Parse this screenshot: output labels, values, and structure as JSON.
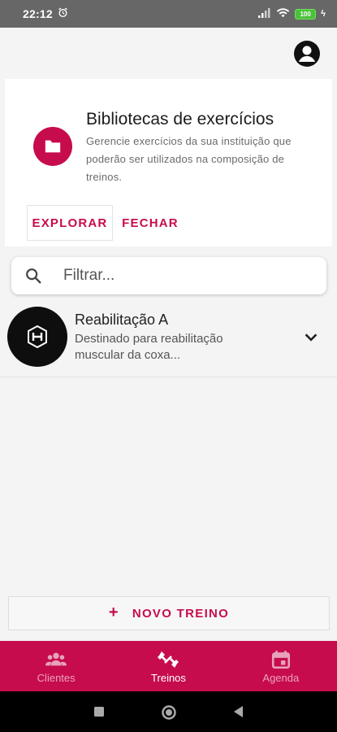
{
  "status_bar": {
    "time": "22:12",
    "battery": "100"
  },
  "library_card": {
    "title": "Bibliotecas de exercícios",
    "description": "Gerencie exercícios da sua instituição que poderão ser utilizados na composição de treinos.",
    "explore_label": "EXPLORAR",
    "close_label": "FECHAR",
    "icon": "folder-icon"
  },
  "search": {
    "placeholder": "Filtrar...",
    "value": ""
  },
  "workouts": [
    {
      "title": "Reabilitação A",
      "description": "Destinado para reabilitação muscular da coxa..."
    }
  ],
  "new_workout_label": "NOVO TREINO",
  "bottom_nav": {
    "items": [
      {
        "label": "Clientes",
        "icon": "people-icon"
      },
      {
        "label": "Treinos",
        "icon": "dumbbell-icon",
        "active": true
      },
      {
        "label": "Agenda",
        "icon": "calendar-icon"
      }
    ]
  },
  "colors": {
    "accent": "#c70c4e",
    "background": "#f4f4f4",
    "status_bar": "#676767"
  }
}
